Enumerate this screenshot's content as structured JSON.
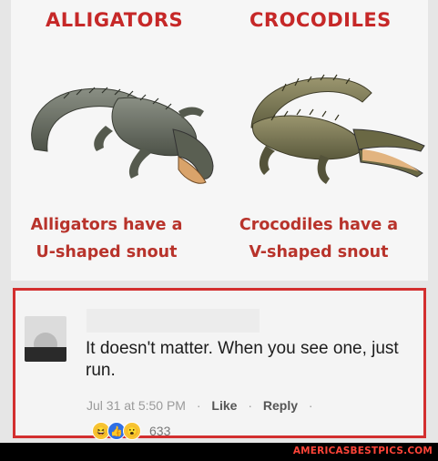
{
  "meme": {
    "left_title": "ALLIGATORS",
    "right_title": "CROCODILES",
    "left_caption_line1": "Alligators have a",
    "left_caption_line2": "U-shaped snout",
    "right_caption_line1": "Crocodiles have a",
    "right_caption_line2": "V-shaped snout"
  },
  "comment": {
    "text": "It doesn't matter. When you see one, just run.",
    "time": "Jul 31 at 5:50 PM",
    "like_label": "Like",
    "reply_label": "Reply",
    "reaction_count": "633",
    "reactions": [
      "haha-icon",
      "like-icon",
      "wow-icon"
    ]
  },
  "footer": {
    "site": "AMERICASBESTPICS.COM"
  },
  "colors": {
    "title_red": "#c62828",
    "border_red": "#d32f2f",
    "footer_red": "#ff4438"
  }
}
